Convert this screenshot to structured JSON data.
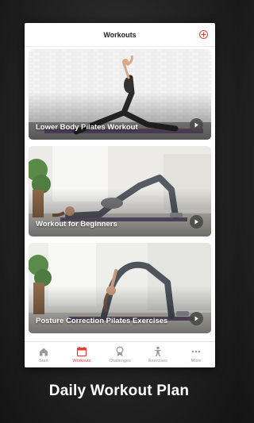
{
  "header": {
    "title": "Workouts",
    "add_icon": "plus-circle-icon"
  },
  "workouts": [
    {
      "title": "Lower Body Pilates Workout",
      "action_icon": "play-icon"
    },
    {
      "title": "Workout for Beginners",
      "action_icon": "play-icon"
    },
    {
      "title": "Posture Correction Pilates Exercises",
      "action_icon": "play-icon"
    }
  ],
  "tabs": [
    {
      "label": "Start",
      "icon": "home-icon",
      "active": false
    },
    {
      "label": "Workouts",
      "icon": "calendar-icon",
      "active": true
    },
    {
      "label": "Challenges",
      "icon": "medal-icon",
      "active": false
    },
    {
      "label": "Exercises",
      "icon": "person-icon",
      "active": false
    },
    {
      "label": "More",
      "icon": "more-icon",
      "active": false
    }
  ],
  "caption": "Daily Workout Plan",
  "colors": {
    "accent": "#e43c3c",
    "background": "#1e1e1e",
    "inactive": "#9a9a9a"
  }
}
